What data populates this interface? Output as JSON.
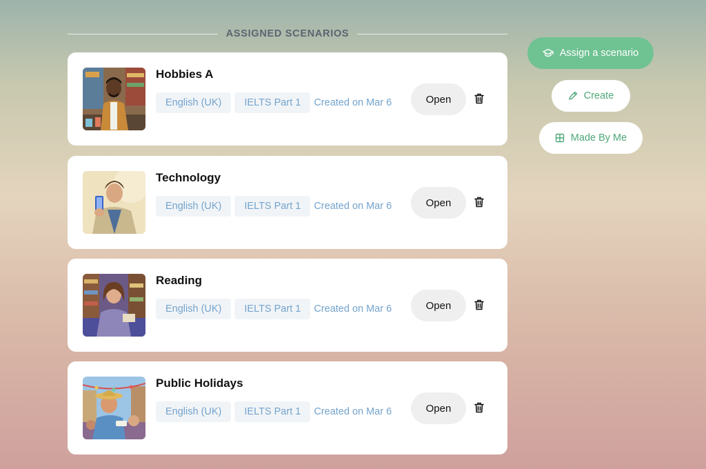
{
  "section": {
    "title": "ASSIGNED SCENARIOS"
  },
  "scenarios": [
    {
      "title": "Hobbies A",
      "language": "English (UK)",
      "level": "IELTS Part 1",
      "created": "Created on Mar 6",
      "open_label": "Open",
      "thumbnail_icon": "man-with-crafts-image"
    },
    {
      "title": "Technology",
      "language": "English (UK)",
      "level": "IELTS Part 1",
      "created": "Created on Mar 6",
      "open_label": "Open",
      "thumbnail_icon": "man-holding-phone-image"
    },
    {
      "title": "Reading",
      "language": "English (UK)",
      "level": "IELTS Part 1",
      "created": "Created on Mar 6",
      "open_label": "Open",
      "thumbnail_icon": "woman-in-library-image"
    },
    {
      "title": "Public Holidays",
      "language": "English (UK)",
      "level": "IELTS Part 1",
      "created": "Created on Mar 6",
      "open_label": "Open",
      "thumbnail_icon": "man-at-festival-image"
    }
  ],
  "actions": {
    "assign": {
      "label": "Assign a scenario",
      "icon": "graduation-cap-icon"
    },
    "create": {
      "label": "Create",
      "icon": "pencil-icon"
    },
    "made_by_me": {
      "label": "Made By Me",
      "icon": "grid-icon"
    }
  },
  "colors": {
    "primary_green": "#6fc292",
    "green_text": "#4da877",
    "tag_text": "#73a3cd",
    "tag_bg": "#f1f4f7"
  }
}
